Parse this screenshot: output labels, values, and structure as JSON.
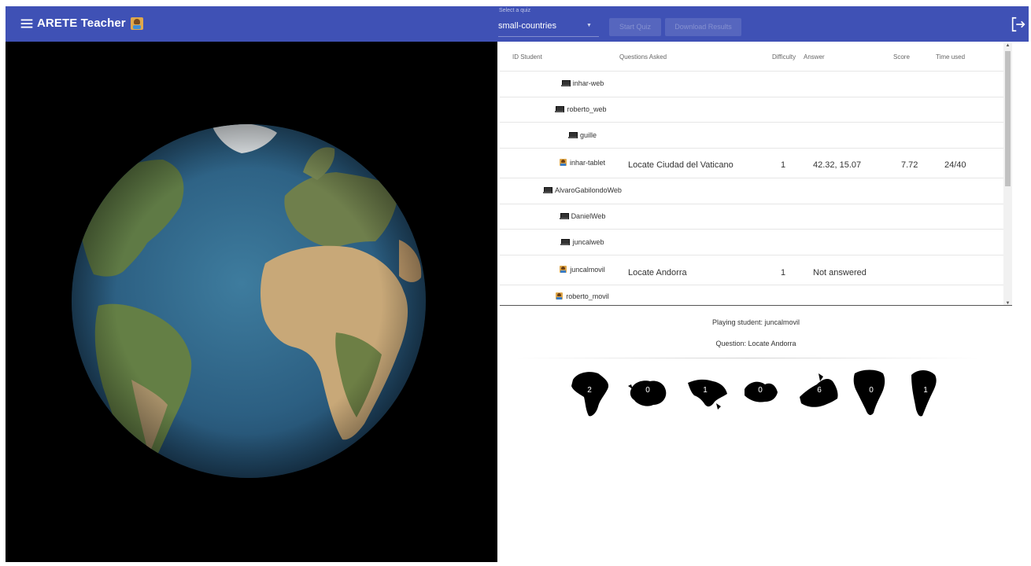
{
  "app": {
    "title": "ARETE Teacher",
    "quiz_select": {
      "label": "Select a quiz",
      "value": "small-countries"
    },
    "start_quiz_label": "Start Quiz",
    "download_results_label": "Download Results"
  },
  "icons": {
    "menu": "menu-icon",
    "logout": "logout-icon",
    "laptop": "laptop-icon",
    "mobile": "mobile-icon"
  },
  "colors": {
    "appbar": "#3f51b5",
    "globe_background": "#000000"
  },
  "table": {
    "columns": [
      "ID Student",
      "Questions Asked",
      "Difficulty",
      "Answer",
      "Score",
      "Time used"
    ],
    "rows": [
      {
        "student": "inhar-web",
        "device": "laptop",
        "question": "",
        "difficulty": "",
        "answer": "",
        "score": "",
        "time": ""
      },
      {
        "student": "roberto_web",
        "device": "laptop",
        "question": "",
        "difficulty": "",
        "answer": "",
        "score": "",
        "time": ""
      },
      {
        "student": "guille",
        "device": "laptop",
        "question": "",
        "difficulty": "",
        "answer": "",
        "score": "",
        "time": ""
      },
      {
        "student": "inhar-tablet",
        "device": "mobile",
        "question": "Locate Ciudad del Vaticano",
        "difficulty": "1",
        "answer": "42.32, 15.07",
        "score": "7.72",
        "time": "24/40"
      },
      {
        "student": "AlvaroGabilondoWeb",
        "device": "laptop",
        "question": "",
        "difficulty": "",
        "answer": "",
        "score": "",
        "time": ""
      },
      {
        "student": "DanielWeb",
        "device": "laptop",
        "question": "",
        "difficulty": "",
        "answer": "",
        "score": "",
        "time": ""
      },
      {
        "student": "juncalweb",
        "device": "laptop",
        "question": "",
        "difficulty": "",
        "answer": "",
        "score": "",
        "time": ""
      },
      {
        "student": "juncalmovil",
        "device": "mobile",
        "question": "Locate Andorra",
        "difficulty": "1",
        "answer": "Not answered",
        "score": "",
        "time": ""
      },
      {
        "student": "roberto_movil",
        "device": "mobile",
        "question": "",
        "difficulty": "",
        "answer": "",
        "score": "",
        "time": ""
      }
    ]
  },
  "playing": {
    "student_line": "Playing student: juncalmovil",
    "question_line": "Question: Locate Andorra"
  },
  "continents": [
    {
      "name": "Africa",
      "count": "2"
    },
    {
      "name": "Antarctica",
      "count": "0"
    },
    {
      "name": "Asia",
      "count": "1"
    },
    {
      "name": "Oceania",
      "count": "0"
    },
    {
      "name": "Europe",
      "count": "6"
    },
    {
      "name": "North America",
      "count": "0"
    },
    {
      "name": "South America",
      "count": "1"
    }
  ]
}
